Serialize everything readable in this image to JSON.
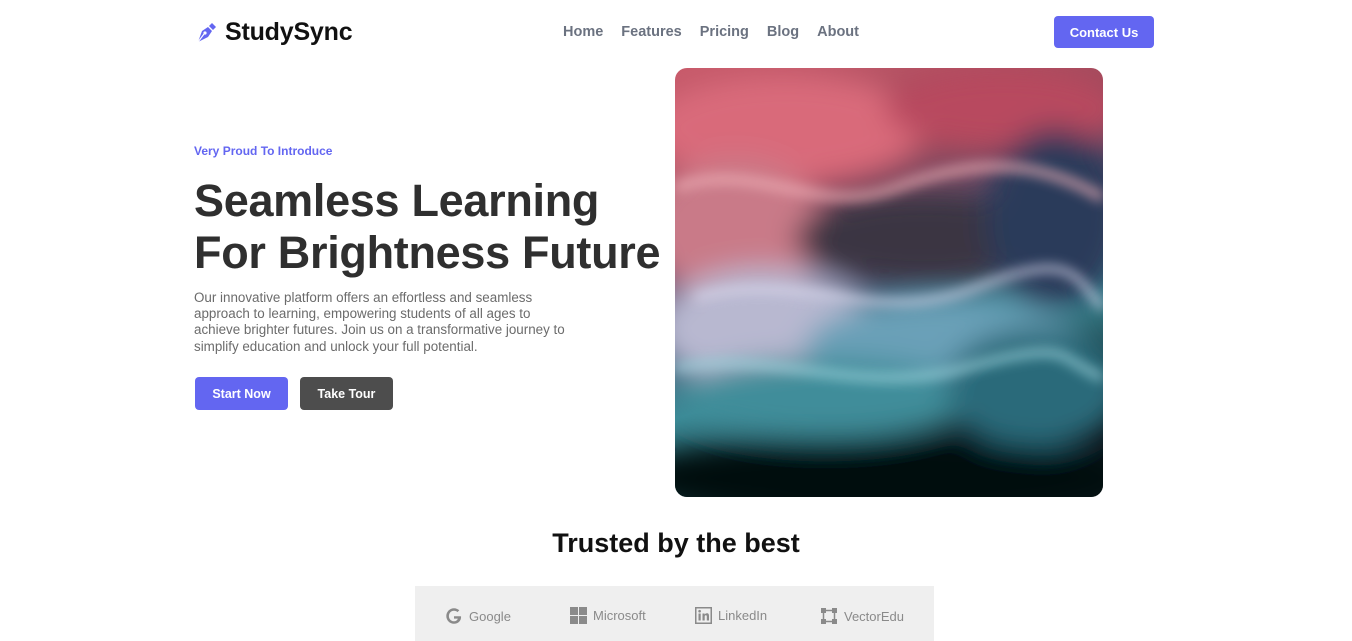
{
  "brand": {
    "name": "StudySync",
    "icon": "pen-nib-icon",
    "accent": "#6366f1"
  },
  "nav": {
    "items": [
      {
        "label": "Home"
      },
      {
        "label": "Features"
      },
      {
        "label": "Pricing"
      },
      {
        "label": "Blog"
      },
      {
        "label": "About"
      }
    ],
    "contact_label": "Contact Us"
  },
  "hero": {
    "eyebrow": "Very Proud To Introduce",
    "headline_line1": "Seamless Learning",
    "headline_line2": "For Brightness Future",
    "description": "Our innovative platform offers an effortless and seamless approach to learning, empowering students of all ages to achieve brighter futures. Join us on a transformative journey to simplify education and unlock your full potential.",
    "primary_cta": "Start Now",
    "secondary_cta": "Take Tour"
  },
  "trusted": {
    "title": "Trusted by the best",
    "logos": [
      {
        "name": "Google",
        "icon": "google-icon"
      },
      {
        "name": "Microsoft",
        "icon": "microsoft-icon"
      },
      {
        "name": "LinkedIn",
        "icon": "linkedin-icon"
      },
      {
        "name": "VectorEdu",
        "icon": "vector-icon"
      }
    ]
  }
}
